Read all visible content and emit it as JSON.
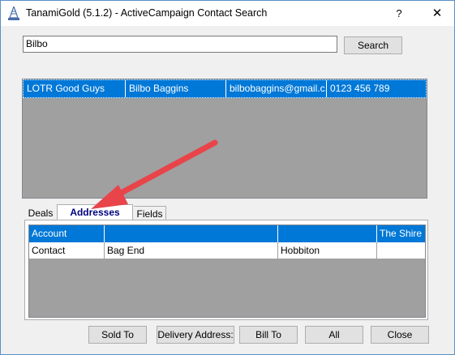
{
  "window": {
    "title": "TanamiGold (5.1.2) - ActiveCampaign Contact Search",
    "help_label": "?",
    "close_label": "✕"
  },
  "search": {
    "value": "Bilbo",
    "button_label": "Search"
  },
  "results": {
    "rows": [
      {
        "list": "LOTR Good Guys",
        "name": "Bilbo Baggins",
        "email": "bilbobaggins@gmail.c...",
        "phone": "0123 456 789"
      }
    ]
  },
  "tabs": [
    {
      "label": "Deals",
      "active": false
    },
    {
      "label": "Addresses",
      "active": true
    },
    {
      "label": "Fields",
      "active": false
    }
  ],
  "addresses": {
    "rows": [
      {
        "type": "Account",
        "street": "",
        "city": "",
        "region": "The Shire",
        "selected": true
      },
      {
        "type": "Contact",
        "street": "Bag End",
        "city": "Hobbiton",
        "region": "",
        "selected": false
      }
    ]
  },
  "footer": {
    "sold_to": "Sold To",
    "delivery_address": "Delivery Address:",
    "bill_to": "Bill To",
    "all": "All",
    "close": "Close"
  },
  "colors": {
    "selection": "#0078d7",
    "annotation_arrow": "#e8444a"
  }
}
